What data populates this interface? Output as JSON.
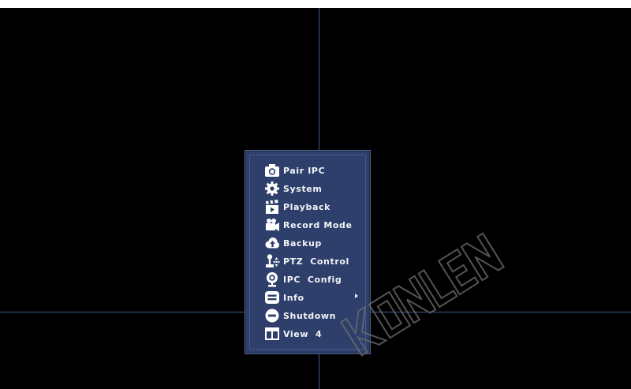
{
  "screen": {
    "background": "#000000",
    "divider_color": "#3e5f86"
  },
  "context_menu": {
    "background": "#2d3f6a",
    "items": [
      {
        "id": "pair-ipc",
        "label": "Pair IPC",
        "icon": "camera-icon"
      },
      {
        "id": "system",
        "label": "System",
        "icon": "gear-icon"
      },
      {
        "id": "playback",
        "label": "Playback",
        "icon": "clapperboard-icon"
      },
      {
        "id": "record-mode",
        "label": "Record Mode",
        "icon": "record-camera-icon"
      },
      {
        "id": "backup",
        "label": "Backup",
        "icon": "cloud-upload-icon"
      },
      {
        "id": "ptz-control",
        "label": "PTZ  Control",
        "icon": "ptz-joystick-icon"
      },
      {
        "id": "ipc-config",
        "label": "IPC  Config",
        "icon": "ip-camera-icon"
      },
      {
        "id": "info",
        "label": "Info",
        "icon": "info-list-icon",
        "has_submenu": true
      },
      {
        "id": "shutdown",
        "label": "Shutdown",
        "icon": "power-icon"
      },
      {
        "id": "view-4",
        "label": "View  4",
        "icon": "layout-icon"
      }
    ]
  },
  "watermark": {
    "text": "KONLEN"
  }
}
